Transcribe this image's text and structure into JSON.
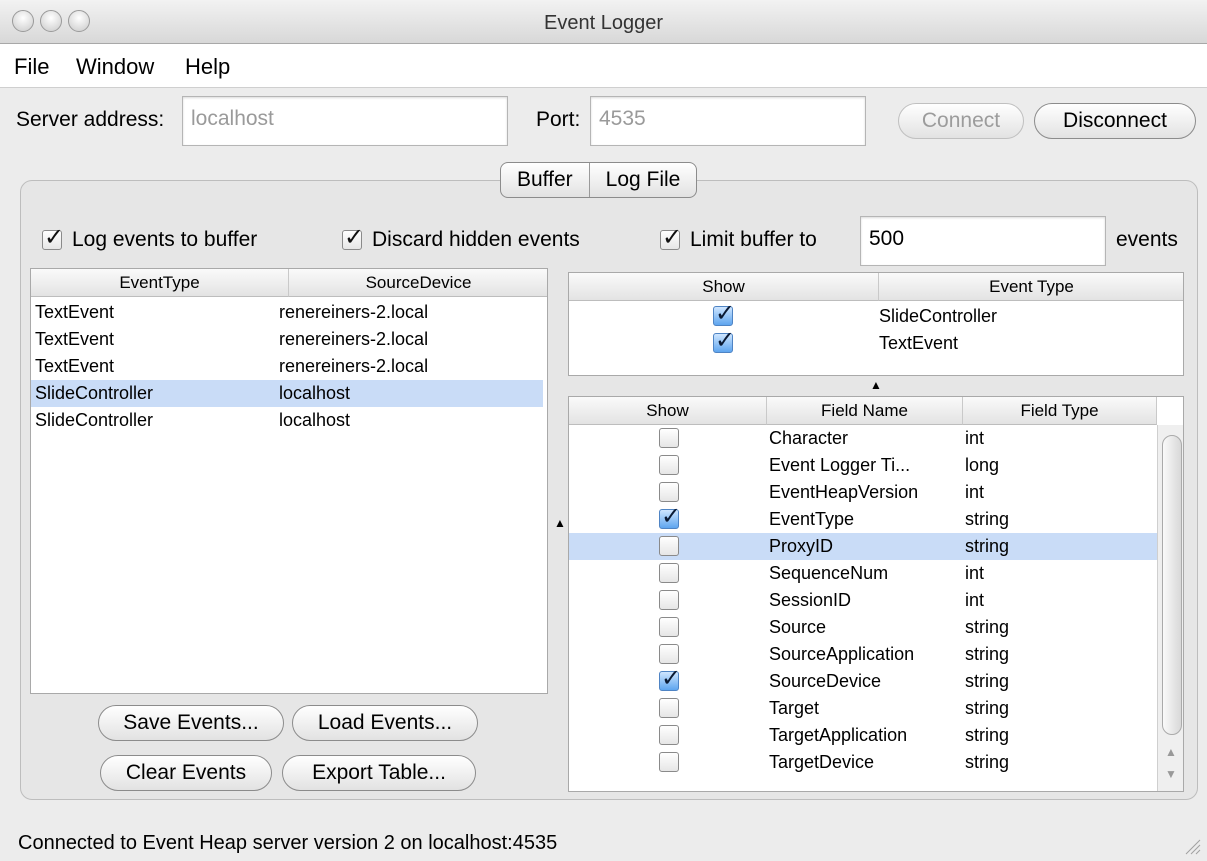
{
  "window": {
    "title": "Event Logger"
  },
  "menu": [
    "File",
    "Window",
    "Help"
  ],
  "server": {
    "address_label": "Server address:",
    "address_value": "localhost",
    "port_label": "Port:",
    "port_value": "4535",
    "connect_label": "Connect",
    "disconnect_label": "Disconnect"
  },
  "tabs": [
    "Buffer",
    "Log File"
  ],
  "options": {
    "log_events": "Log events to buffer",
    "discard_hidden": "Discard hidden events",
    "limit_buffer": "Limit buffer to",
    "limit_value": "500",
    "events_suffix": "events"
  },
  "events_table": {
    "headers": [
      "EventType",
      "SourceDevice"
    ],
    "rows": [
      [
        "TextEvent",
        "renereiners-2.local"
      ],
      [
        "TextEvent",
        "renereiners-2.local"
      ],
      [
        "TextEvent",
        "renereiners-2.local"
      ],
      [
        "SlideController",
        "localhost"
      ],
      [
        "SlideController",
        "localhost"
      ]
    ],
    "selected_index": 3
  },
  "buttons": {
    "save": "Save Events...",
    "load": "Load Events...",
    "clear": "Clear Events",
    "export": "Export Table..."
  },
  "type_filter": {
    "headers": [
      "Show",
      "Event Type"
    ],
    "rows": [
      {
        "show": true,
        "name": "SlideController"
      },
      {
        "show": true,
        "name": "TextEvent"
      }
    ]
  },
  "fields_table": {
    "headers": [
      "Show",
      "Field Name",
      "Field Type"
    ],
    "rows": [
      {
        "show": false,
        "name": "Character",
        "type": "int"
      },
      {
        "show": false,
        "name": "Event Logger Ti...",
        "type": "long"
      },
      {
        "show": false,
        "name": "EventHeapVersion",
        "type": "int"
      },
      {
        "show": true,
        "name": "EventType",
        "type": "string"
      },
      {
        "show": false,
        "name": "ProxyID",
        "type": "string"
      },
      {
        "show": false,
        "name": "SequenceNum",
        "type": "int"
      },
      {
        "show": false,
        "name": "SessionID",
        "type": "int"
      },
      {
        "show": false,
        "name": "Source",
        "type": "string"
      },
      {
        "show": false,
        "name": "SourceApplication",
        "type": "string"
      },
      {
        "show": true,
        "name": "SourceDevice",
        "type": "string"
      },
      {
        "show": false,
        "name": "Target",
        "type": "string"
      },
      {
        "show": false,
        "name": "TargetApplication",
        "type": "string"
      },
      {
        "show": false,
        "name": "TargetDevice",
        "type": "string"
      }
    ],
    "selected_index": 4
  },
  "status": "Connected to Event Heap server version 2 on localhost:4535"
}
